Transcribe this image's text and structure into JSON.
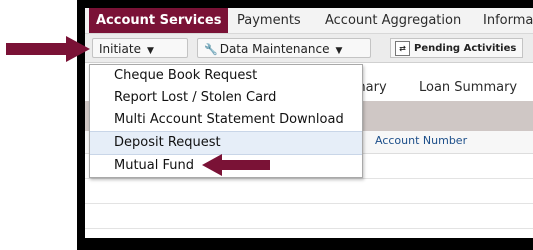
{
  "nav": {
    "tabs": [
      {
        "label": "Account Services"
      },
      {
        "label": "Payments"
      },
      {
        "label": "Account Aggregation"
      },
      {
        "label": "Informa"
      }
    ]
  },
  "toolbar": {
    "initiate_label": "Initiate",
    "data_maintenance_label": "Data Maintenance",
    "pending_label": "Pending Activities"
  },
  "content": {
    "tabs": [
      {
        "label": "mary"
      },
      {
        "label": "Loan Summary"
      }
    ],
    "column_header": "Account Number"
  },
  "dropdown": {
    "items": [
      {
        "label": "Cheque Book Request"
      },
      {
        "label": "Report Lost / Stolen Card"
      },
      {
        "label": "Multi Account Statement Download"
      },
      {
        "label": "Deposit Request"
      },
      {
        "label": "Mutual Fund"
      }
    ]
  },
  "colors": {
    "active_tab": "#7a1236",
    "arrow": "#7a1236",
    "highlight": "#e6eef8"
  }
}
